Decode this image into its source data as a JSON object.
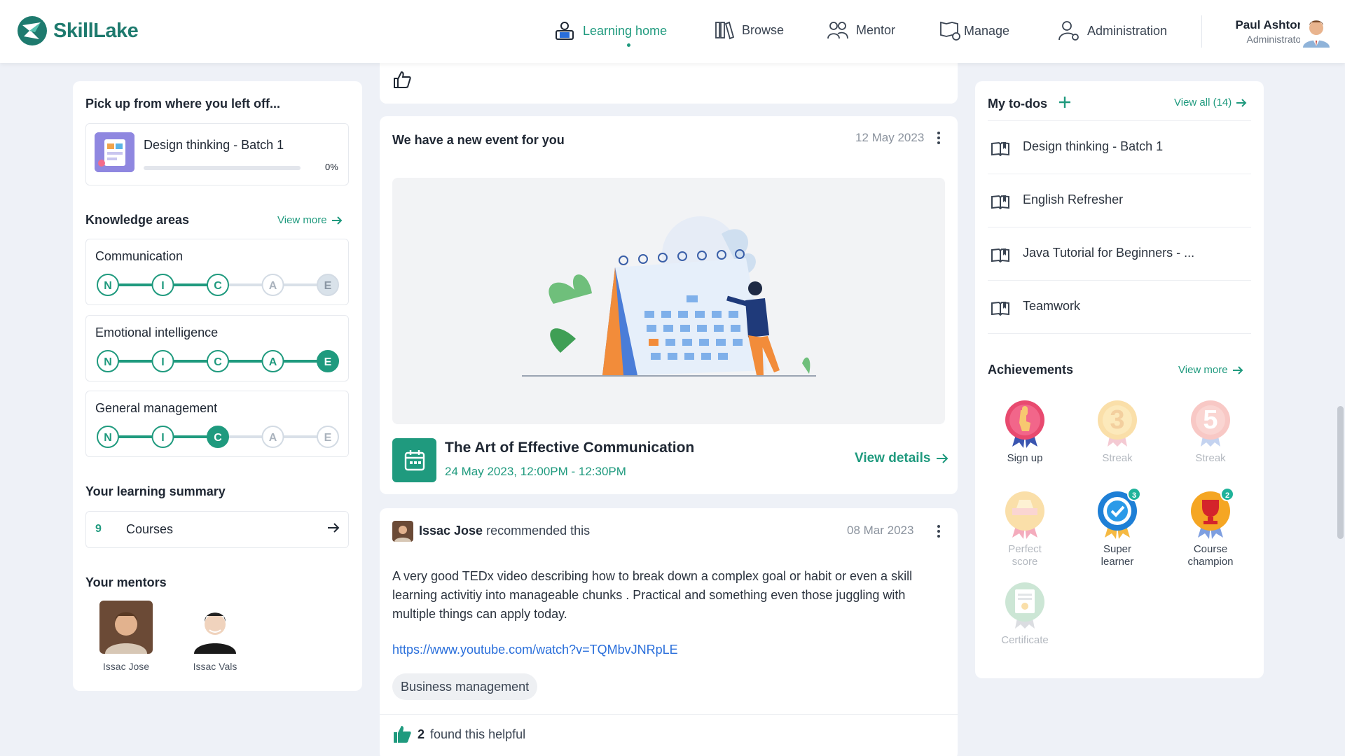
{
  "app": {
    "logo_text_1": "Skill",
    "logo_text_2": "Lake"
  },
  "nav": {
    "items": [
      {
        "label": "Learning home",
        "icon": "learning-home-icon",
        "active": true
      },
      {
        "label": "Browse",
        "icon": "library-icon"
      },
      {
        "label": "Mentor",
        "icon": "people-icon"
      },
      {
        "label": "Manage",
        "icon": "manage-icon"
      },
      {
        "label": "Administration",
        "icon": "admin-user-icon"
      }
    ]
  },
  "user": {
    "name": "Paul Ashton",
    "role": "Administrator"
  },
  "left": {
    "resume_title": "Pick up from where you left off...",
    "resume_item": {
      "title": "Design thinking - Batch 1",
      "progress_label": "0%",
      "progress": 0
    },
    "knowledge_title": "Knowledge areas",
    "knowledge_view_more": "View more",
    "levels": [
      "N",
      "I",
      "C",
      "A",
      "E"
    ],
    "areas": [
      {
        "name": "Communication",
        "level": 3,
        "target": 5
      },
      {
        "name": "Emotional intelligence",
        "level": 5,
        "target": 5
      },
      {
        "name": "General management",
        "level": 3,
        "target": 3
      }
    ],
    "summary_title": "Your learning summary",
    "summary": {
      "count": "9",
      "label": "Courses"
    },
    "mentors_title": "Your mentors",
    "mentors": [
      {
        "name": "Issac Jose"
      },
      {
        "name": "Issac Vals"
      }
    ]
  },
  "event": {
    "heading": "We have a new event for you",
    "date": "12 May 2023",
    "title": "The Art of Effective Communication",
    "time": "24 May 2023, 12:00PM - 12:30PM",
    "view_details": "View details"
  },
  "recommendation": {
    "who": "Issac Jose",
    "action": " recommended this",
    "date": "08 Mar 2023",
    "text": "A very good TEDx video describing how to break down a complex goal or habit or even a skill learning activitiy into manageable chunks . Practical and something even those juggling with multiple things can apply today.",
    "link": "https://www.youtube.com/watch?v=TQMbvJNRpLE",
    "tag": "Business management",
    "helpful_count": "2",
    "helpful_label": "found this helpful"
  },
  "todos": {
    "title": "My to-dos",
    "view_all": "View all (14)",
    "items": [
      {
        "label": "Design thinking - Batch 1"
      },
      {
        "label": "English Refresher"
      },
      {
        "label": "Java Tutorial for Beginners - ..."
      },
      {
        "label": "Teamwork"
      }
    ]
  },
  "achievements": {
    "title": "Achievements",
    "view_more": "View more",
    "items": [
      {
        "label": "Sign up",
        "earned": true
      },
      {
        "label": "Streak",
        "earned": false,
        "number": "3"
      },
      {
        "label": "Streak",
        "earned": false,
        "number": "5"
      },
      {
        "label": "Perfect score",
        "earned": false
      },
      {
        "label": "Super learner",
        "earned": true,
        "count": "3"
      },
      {
        "label": "Course champion",
        "earned": true,
        "count": "2"
      },
      {
        "label": "Certificate",
        "earned": false
      }
    ]
  },
  "colors": {
    "accent": "#1f9a7e",
    "link": "#2a6fdb",
    "background": "#eef1f7"
  }
}
